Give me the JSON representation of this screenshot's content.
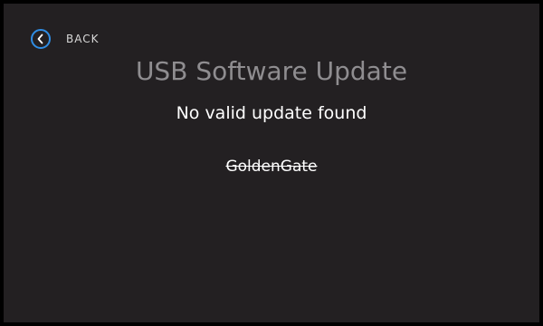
{
  "header": {
    "back_label": "BACK",
    "back_icon": "chevron-left-icon"
  },
  "main": {
    "title": "USB Software Update",
    "status_message": "No valid update found",
    "device_name": "GoldenGate"
  },
  "colors": {
    "background": "#232022",
    "frame": "#000000",
    "accent": "#2f8de4",
    "title": "#8f8d90",
    "text": "#ffffff"
  }
}
